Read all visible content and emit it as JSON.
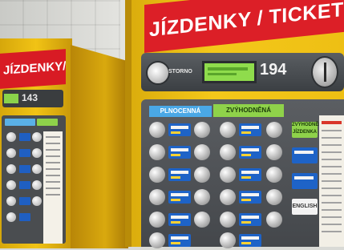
{
  "scene": {
    "description_colors": {
      "machine_yellow": "#f4c81a",
      "banner_red": "#dc1f27",
      "panel_gray": "#4a4d50",
      "lcd_green": "#8fdc4c",
      "tag_blue": "#1e63c7"
    }
  },
  "left_machine": {
    "banner_text": "JÍZDENKY/TICKETS",
    "price": "143"
  },
  "right_machine": {
    "banner_text": "JÍZDENKY / TICKETS",
    "storno_label": "STORNO",
    "price": "194",
    "header_full": "PLNOCENNÁ",
    "header_discount": "ZVÝHODNĚNÁ",
    "side_button_label": "ZVÝHODNĚNÁ JÍZDENKA",
    "english_button_label": "ENGLISH"
  }
}
